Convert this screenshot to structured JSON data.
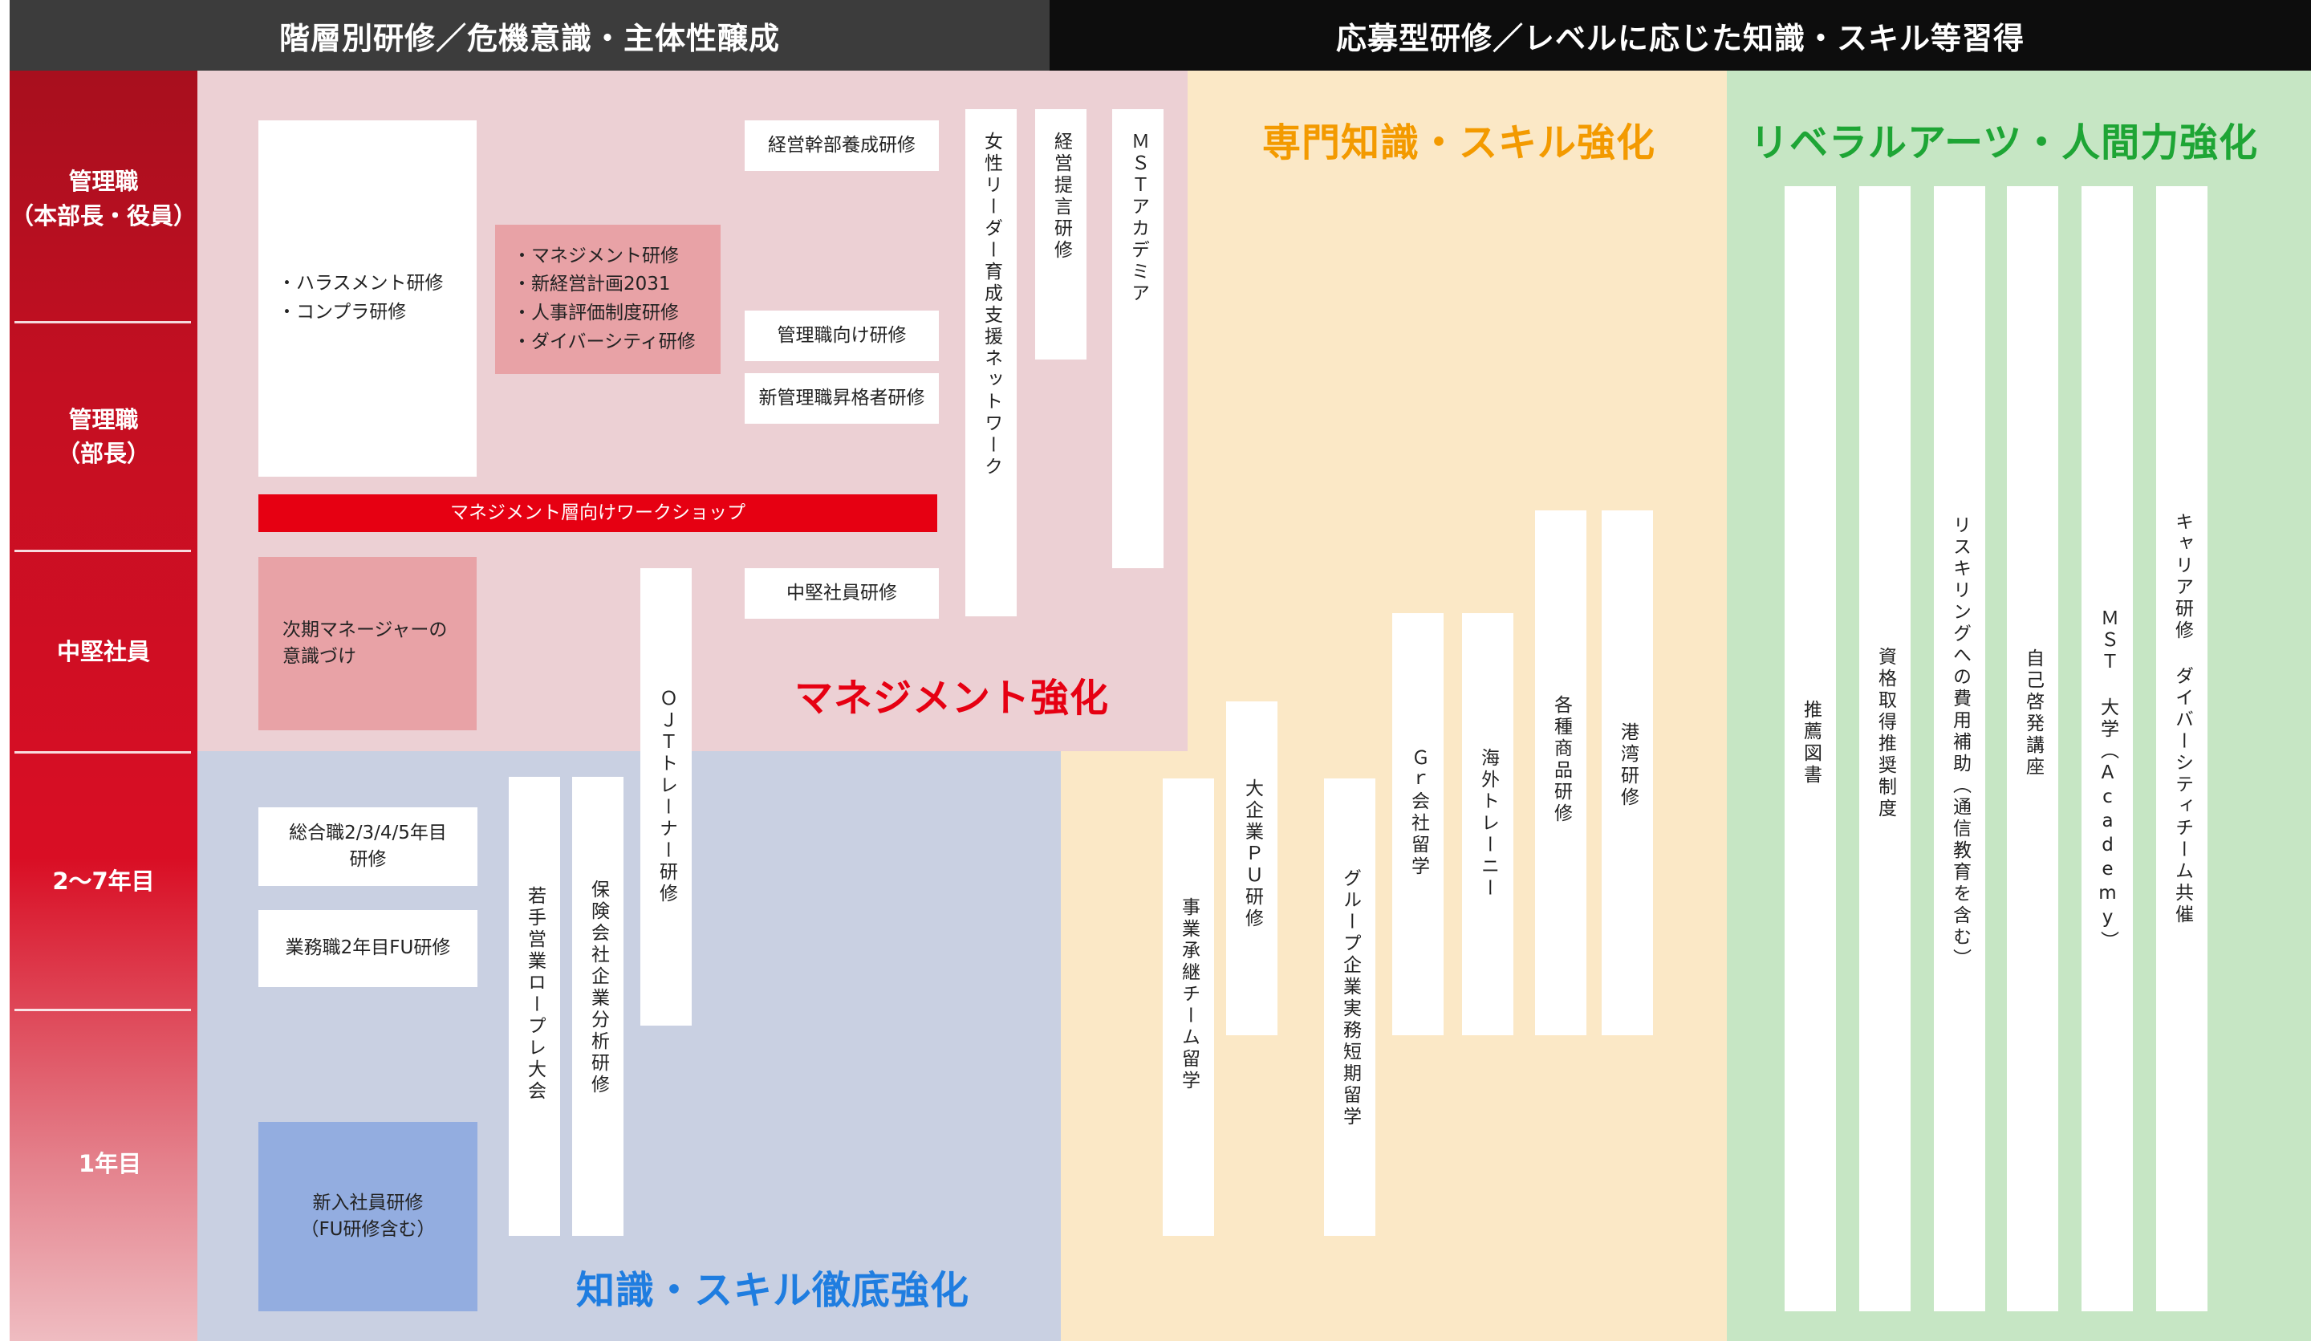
{
  "headers": {
    "left": "階層別研修／危機意識・主体性醸成",
    "right": "応募型研修／レベルに応じた知識・スキル等習得"
  },
  "levels": [
    {
      "label": "管理職\n（本部長・役員）"
    },
    {
      "label": "管理職\n（部長）"
    },
    {
      "label": "中堅社員"
    },
    {
      "label": "2〜7年目"
    },
    {
      "label": "1年目"
    }
  ],
  "zones": {
    "management": "マネジメント強化",
    "knowledge": "知識・スキル徹底強化",
    "specialist": "専門知識・スキル強化",
    "liberal": "リベラルアーツ・人間力強化"
  },
  "management_items": {
    "harassment_list": "・ハラスメント研修\n・コンプラ研修",
    "mgmt_list": "・マネジメント研修\n・新経営計画2031\n・人事評価制度研修\n・ダイバーシティ研修",
    "exec_training": "経営幹部養成研修",
    "manager_training": "管理職向け研修",
    "new_manager_training": "新管理職昇格者研修",
    "workshop": "マネジメント層向けワークショップ",
    "next_manager": "次期マネージャーの\n意識づけ",
    "mid_career_training": "中堅社員研修",
    "women_leader_network": "女性リーダー育成支援ネットワーク",
    "management_proposal": "経営提言研修",
    "mst_academy": "ＭＳＴアカデミア",
    "ojt_trainer": "ＯＪＴトレーナー研修"
  },
  "knowledge_items": {
    "career_year_training": "総合職2/3/4/5年目\n研修",
    "clerical_fu": "業務職2年目FU研修",
    "new_hire": "新入社員研修\n（FU研修含む）",
    "young_sales_roleplay": "若手営業ロープレ大会",
    "insurer_analysis": "保険会社企業分析研修"
  },
  "specialist_items": [
    {
      "label": "事業承継チーム留学"
    },
    {
      "label": "大企業ＰＵ研修"
    },
    {
      "label": "グループ企業実務短期留学"
    },
    {
      "label": "Ｇｒ会社留学"
    },
    {
      "label": "海外トレーニー"
    },
    {
      "label": "各種商品研修"
    },
    {
      "label": "港湾研修"
    }
  ],
  "liberal_items": [
    {
      "label": "推薦図書"
    },
    {
      "label": "資格取得推奨制度"
    },
    {
      "label": "リスキリングへの費用補助（通信教育を含む）"
    },
    {
      "label": "自己啓発講座"
    },
    {
      "label": "ＭＳＴ 大学（Academy）"
    },
    {
      "label": "キャリア研修 ダイバーシティチーム共催"
    }
  ],
  "colors": {
    "header_left": "#3c3c3c",
    "header_right": "#0d0d0d",
    "sidebar_top": "#a80f1e",
    "sidebar_bottom": "#eab0b6",
    "management_bg": "#ecd0d4",
    "knowledge_bg": "#c9d0e2",
    "specialist_bg": "#fbe8c6",
    "liberal_bg": "#c6e6c4",
    "pink_box": "#e8a2a6",
    "workshop_red": "#e60012",
    "new_hire_blue": "#93ade0",
    "management_title": "#e60012",
    "knowledge_title": "#1f7de0",
    "specialist_title": "#f39a00",
    "liberal_title": "#1ea535"
  }
}
